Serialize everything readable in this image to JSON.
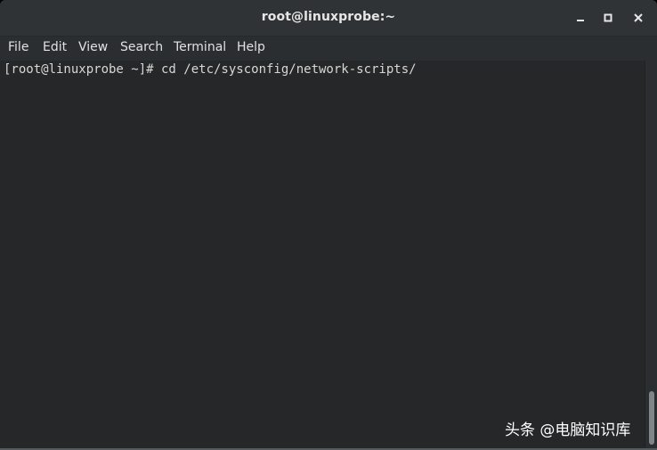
{
  "window": {
    "title": "root@linuxprobe:~"
  },
  "window_controls": {
    "minimize_icon": "minimize-icon",
    "maximize_icon": "maximize-icon",
    "close_icon": "close-icon"
  },
  "menubar": {
    "items": [
      "File",
      "Edit",
      "View",
      "Search",
      "Terminal",
      "Help"
    ]
  },
  "terminal": {
    "lines": [
      "[root@linuxprobe ~]# cd /etc/sysconfig/network-scripts/"
    ]
  },
  "watermark": {
    "text": "头条 @电脑知识库"
  },
  "colors": {
    "titlebar": "#2f3335",
    "terminal_bg": "#252728",
    "text": "#d7d7d7"
  }
}
